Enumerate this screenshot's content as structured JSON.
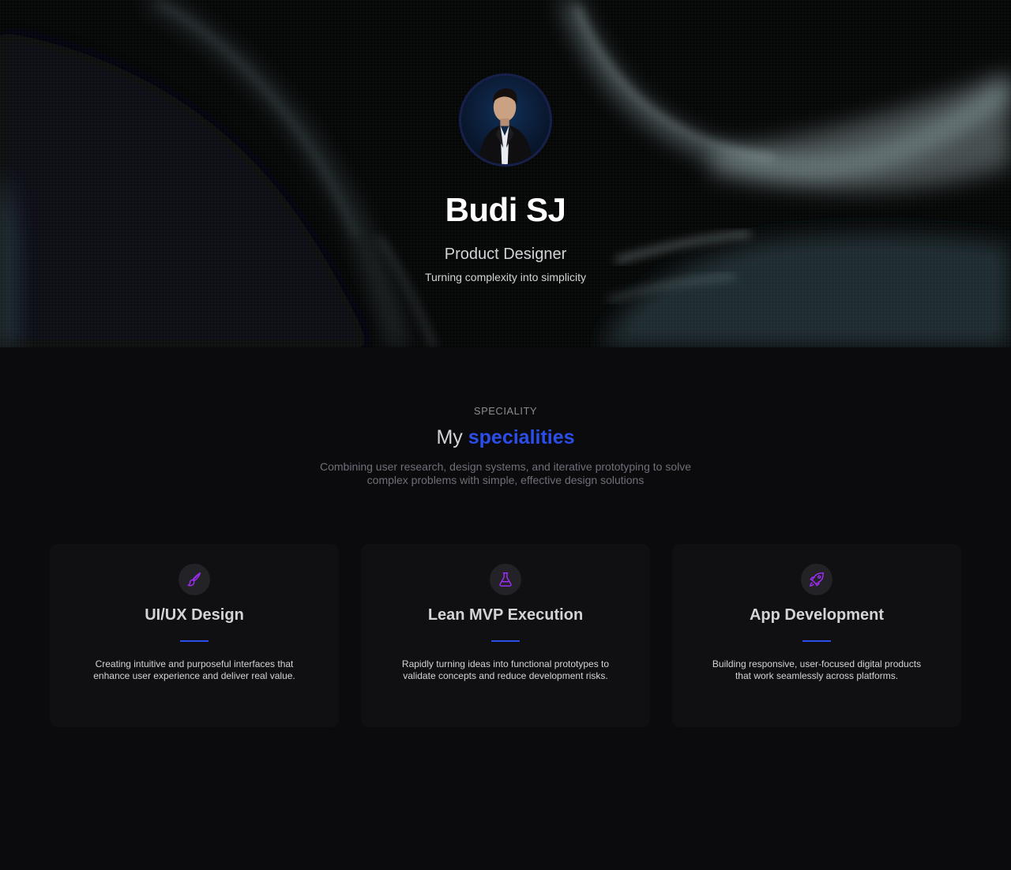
{
  "hero": {
    "name": "Budi SJ",
    "role": "Product Designer",
    "tagline": "Turning complexity into simplicity"
  },
  "speciality": {
    "eyebrow": "SPECIALITY",
    "title_prefix": "My",
    "title_accent": "specialities",
    "description": "Combining user research, design systems, and iterative prototyping to solve complex problems with simple, effective design solutions",
    "cards": [
      {
        "icon": "paintbrush-icon",
        "title": "UI/UX Design",
        "description": "Creating intuitive and purposeful interfaces that enhance user experience and deliver real value."
      },
      {
        "icon": "flask-icon",
        "title": "Lean MVP Execution",
        "description": "Rapidly turning ideas into functional prototypes to validate concepts and reduce development risks."
      },
      {
        "icon": "rocket-icon",
        "title": "App Development",
        "description": "Building responsive, user-focused digital products that work seamlessly across platforms."
      }
    ]
  },
  "colors": {
    "background": "#0b0b0e",
    "card": "#101013",
    "accent": "#2b4eeb",
    "icon": "#9b2cf0",
    "text": "#d4d4d8",
    "muted": "#6f6f78"
  }
}
